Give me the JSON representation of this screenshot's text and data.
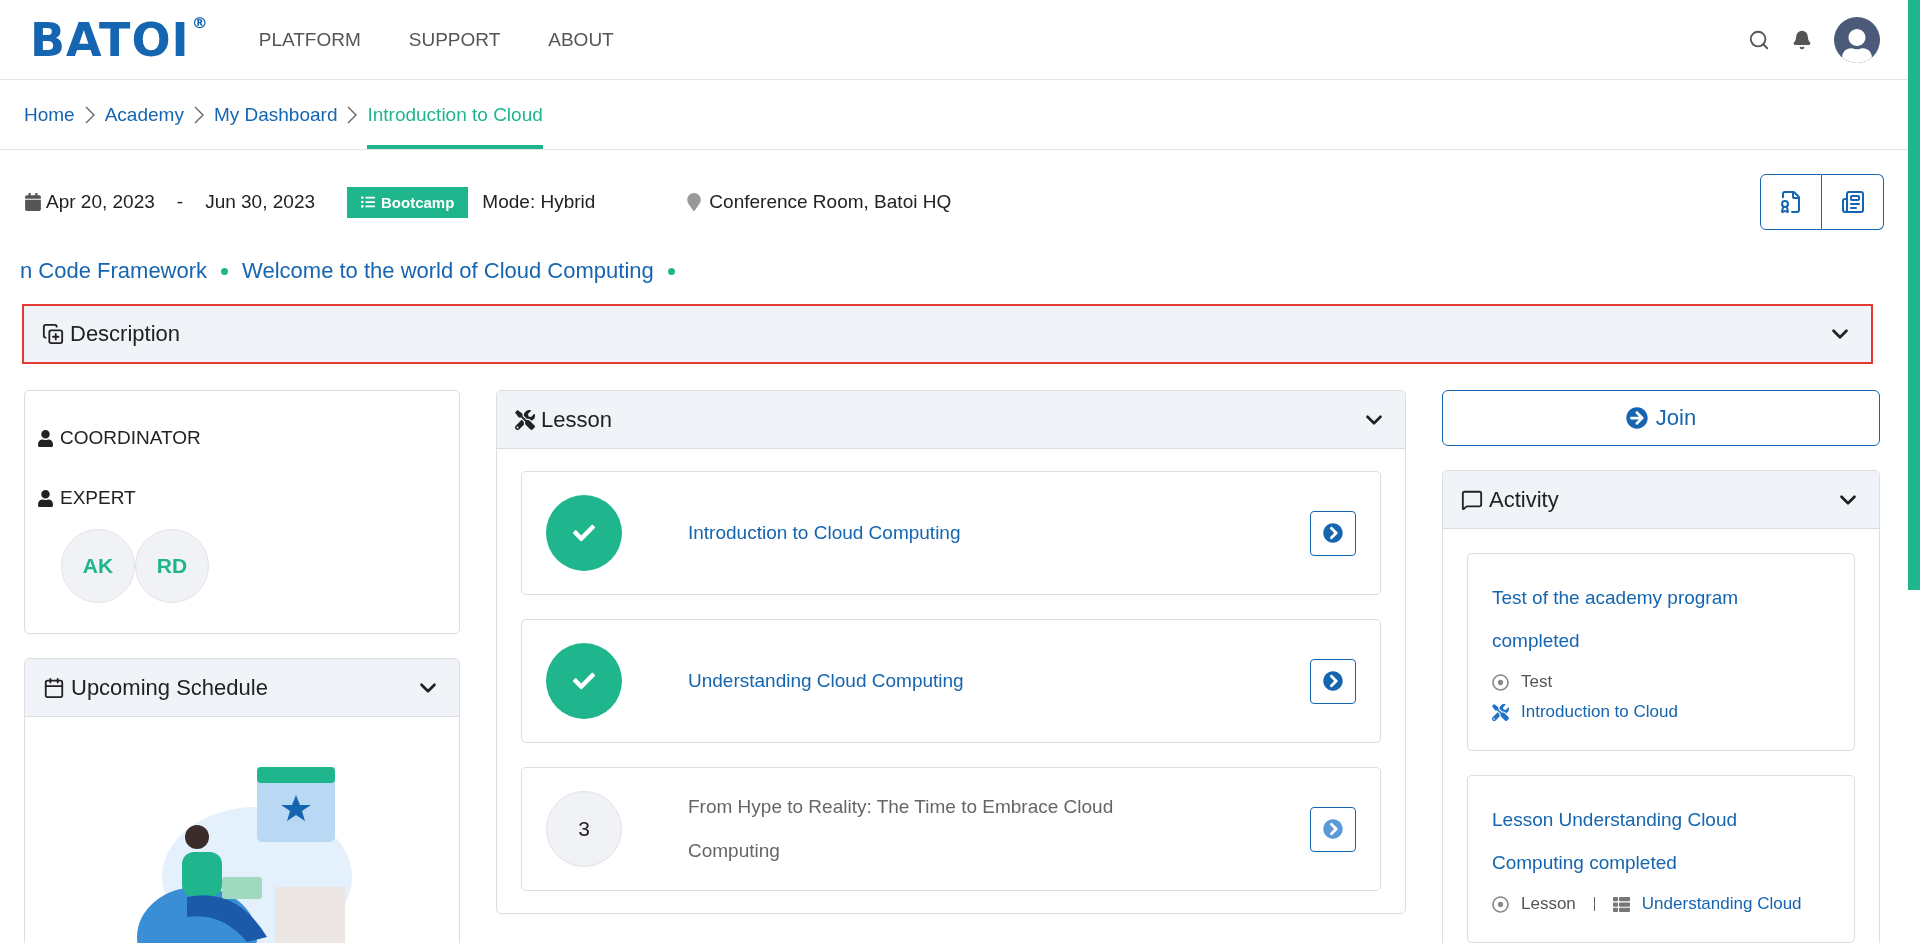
{
  "header": {
    "logo": "BATOI",
    "logo_mark": "®",
    "nav": [
      "PLATFORM",
      "SUPPORT",
      "ABOUT"
    ]
  },
  "breadcrumb": [
    {
      "label": "Home",
      "selected": false
    },
    {
      "label": "Academy",
      "selected": false
    },
    {
      "label": "My Dashboard",
      "selected": false
    },
    {
      "label": "Introduction to Cloud",
      "selected": true
    }
  ],
  "info": {
    "start": "Apr 20, 2023",
    "dash": "-",
    "end": "Jun 30, 2023",
    "badge": "Bootcamp",
    "mode": "Mode: Hybrid",
    "location": "Conference Room, Batoi HQ"
  },
  "ticker": [
    "n Code Framework",
    "Welcome to the world of Cloud Computing"
  ],
  "description": {
    "title": "Description",
    "expanded": false
  },
  "people": {
    "roles": [
      "COORDINATOR",
      "EXPERT"
    ],
    "experts": [
      "AK",
      "RD"
    ]
  },
  "schedule": {
    "title": "Upcoming Schedule"
  },
  "lesson": {
    "title": "Lesson",
    "items": [
      {
        "title": "Introduction to Cloud Computing",
        "completed": true
      },
      {
        "title": "Understanding Cloud Computing",
        "completed": true
      },
      {
        "title": "From Hype to Reality: The Time to Embrace Cloud Computing",
        "completed": false,
        "number": "3"
      }
    ]
  },
  "join": "Join",
  "activity": {
    "title": "Activity",
    "items": [
      {
        "title": "Test of the academy program completed",
        "rows": [
          [
            {
              "kind": "type",
              "text": "Test"
            }
          ],
          [
            {
              "kind": "lesson",
              "text": "Introduction to Cloud"
            }
          ]
        ]
      },
      {
        "title": "Lesson Understanding Cloud Computing completed",
        "rows": [
          [
            {
              "kind": "type",
              "text": "Lesson"
            },
            {
              "kind": "section",
              "text": "Understanding Cloud"
            }
          ]
        ]
      }
    ]
  }
}
